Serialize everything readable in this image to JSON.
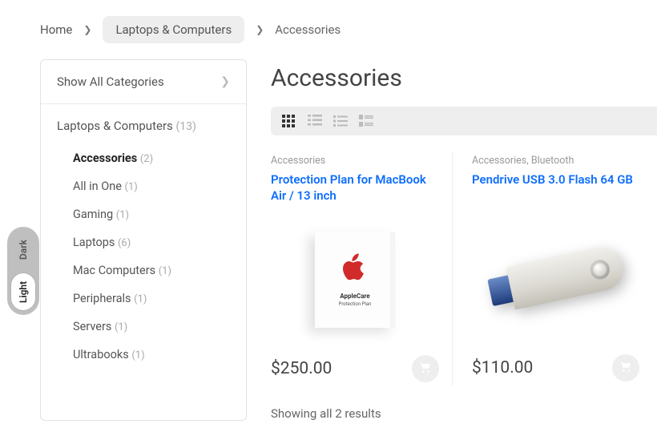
{
  "breadcrumb": {
    "home": "Home",
    "parent": "Laptops & Computers",
    "current": "Accessories"
  },
  "sidebar": {
    "show_all": "Show All Categories",
    "parent_label": "Laptops & Computers",
    "parent_count": "(13)",
    "items": [
      {
        "label": "Accessories",
        "count": "(2)",
        "active": true
      },
      {
        "label": "All in One",
        "count": "(1)",
        "active": false
      },
      {
        "label": "Gaming",
        "count": "(1)",
        "active": false
      },
      {
        "label": "Laptops",
        "count": "(6)",
        "active": false
      },
      {
        "label": "Mac Computers",
        "count": "(1)",
        "active": false
      },
      {
        "label": "Peripherals",
        "count": "(1)",
        "active": false
      },
      {
        "label": "Servers",
        "count": "(1)",
        "active": false
      },
      {
        "label": "Ultrabooks",
        "count": "(1)",
        "active": false
      }
    ]
  },
  "page": {
    "title": "Accessories",
    "results_text": "Showing all 2 results"
  },
  "products": [
    {
      "category": "Accessories",
      "title": "Protection Plan for MacBook Air / 13 inch",
      "price": "$250.00",
      "image": "applecare"
    },
    {
      "category": "Accessories, Bluetooth",
      "title": "Pendrive USB 3.0 Flash 64 GB",
      "price": "$110.00",
      "image": "pendrive"
    }
  ],
  "theme": {
    "dark": "Dark",
    "light": "Light"
  },
  "applecare": {
    "label": "AppleCare",
    "sub": "Protection Plan"
  }
}
